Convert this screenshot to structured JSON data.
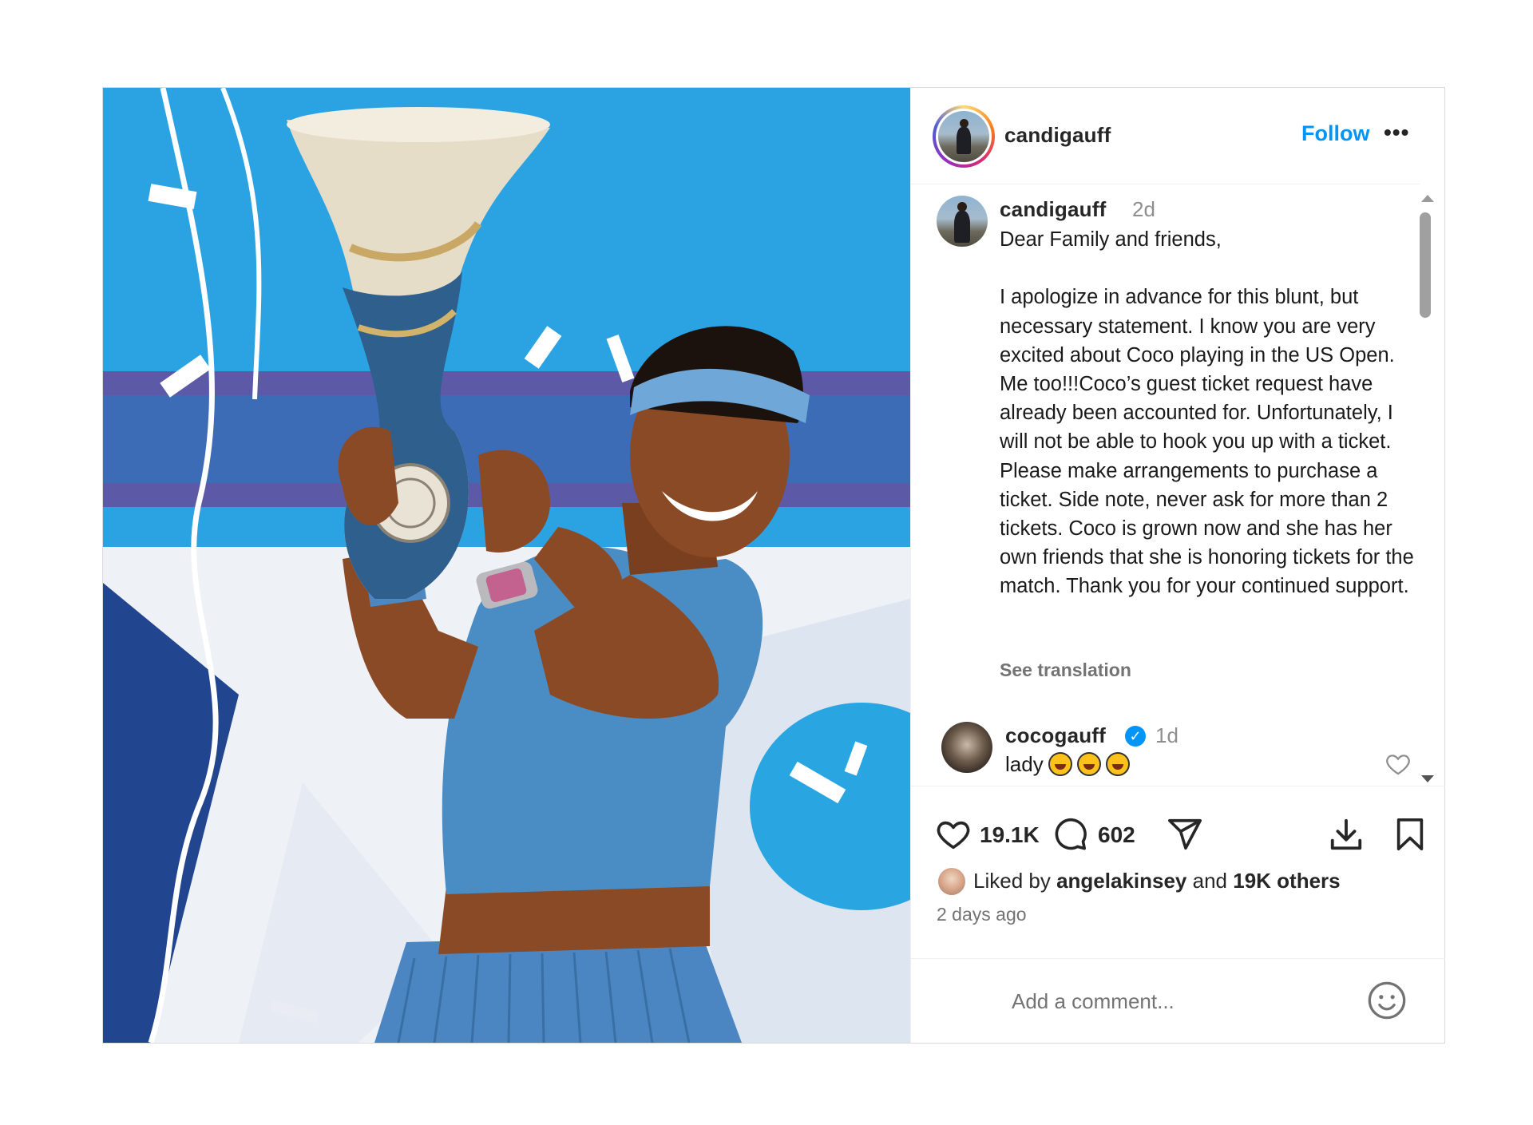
{
  "post": {
    "author": "candigauff",
    "follow_label": "Follow",
    "more_label": "•••",
    "image_label": "Woman in blue tennis outfit holding a trophy"
  },
  "caption": {
    "username": "candigauff",
    "time": "2d",
    "text": "Dear Family and friends,\n\nI apologize in advance for this blunt, but necessary statement. I know you are very excited about Coco playing in the US Open. Me too!!!Coco’s guest ticket request have already been accounted for. Unfortunately, I will not be able to hook you up with a ticket. Please make arrangements to purchase a ticket. Side note, never ask for more than 2 tickets. Coco is grown now and she has her own friends that she is honoring tickets for the match. Thank you for your continued support.",
    "see_translation": "See translation"
  },
  "comment": {
    "username": "cocogauff",
    "verified": "✓",
    "time": "1d",
    "text": "lady"
  },
  "actions": {
    "like_count": "19.1K",
    "comment_count": "602"
  },
  "likes": {
    "prefix": "Liked by",
    "user": "angelakinsey",
    "and": "and",
    "others": "19K others"
  },
  "posted_ago": "2 days ago",
  "comment_input": {
    "placeholder": "Add a comment..."
  },
  "colors": {
    "accent": "#0095f6",
    "photo_bg": "#2fa9e6",
    "outfit": "#4a8cc4"
  }
}
